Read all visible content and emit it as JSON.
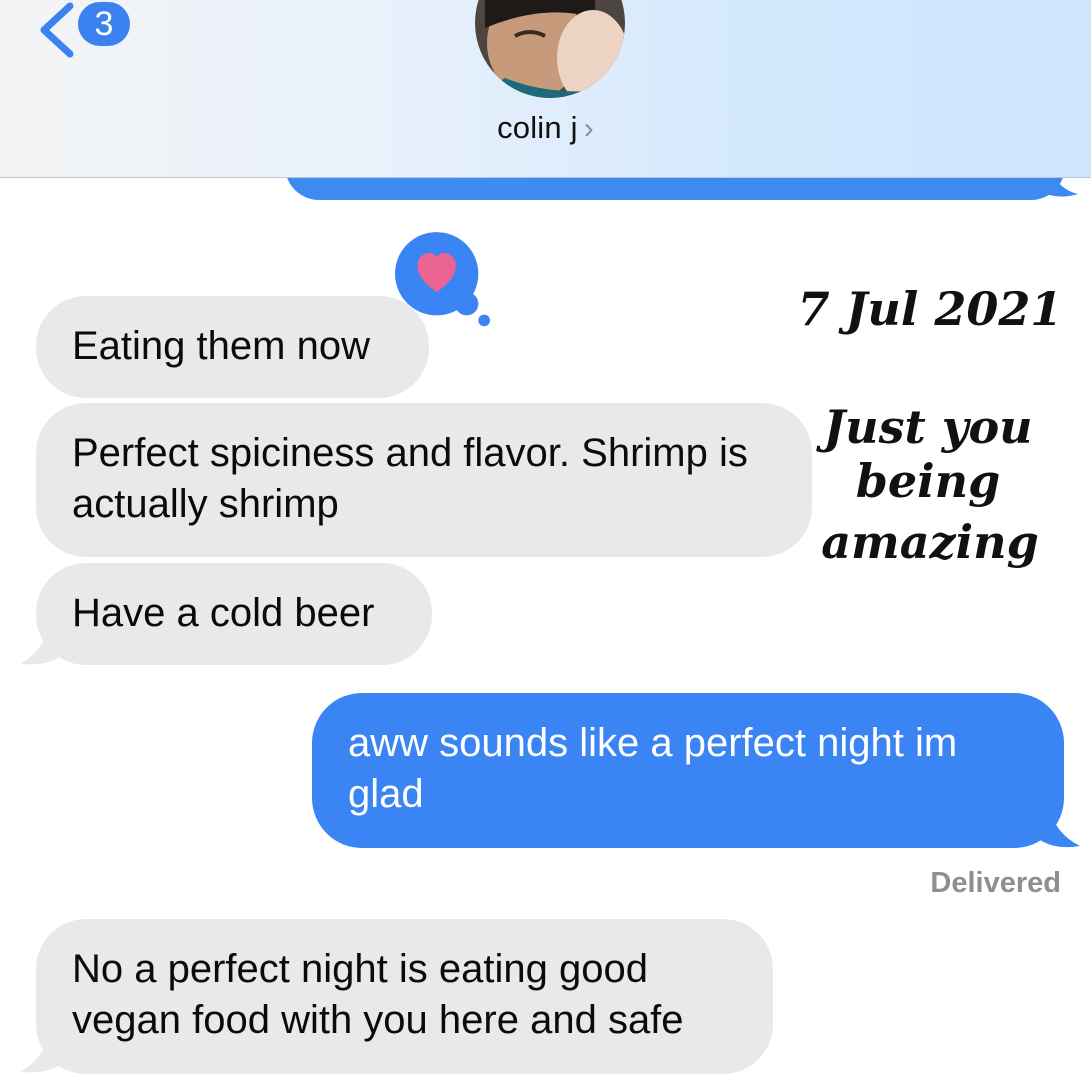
{
  "header": {
    "unread_count": "3",
    "contact_name": "colin j",
    "chevron": "›",
    "back_icon": "chevron-left-icon",
    "avatar": "contact-avatar-photo"
  },
  "reaction": {
    "icon": "heart-icon",
    "color": "#ea6391"
  },
  "messages": [
    {
      "direction": "incoming",
      "text": "Eating them now"
    },
    {
      "direction": "incoming",
      "text": "Perfect spiciness and flavor. Shrimp is actually shrimp"
    },
    {
      "direction": "incoming",
      "text": "Have a cold beer"
    },
    {
      "direction": "outgoing",
      "text": "aww sounds like a perfect night im glad"
    },
    {
      "direction": "incoming",
      "text": "No a perfect night is eating good vegan food with you here and safe"
    }
  ],
  "status": {
    "delivered": "Delivered"
  },
  "overlay": {
    "date": "7 Jul 2021",
    "caption_line1": "Just you being",
    "caption_line2": "amazing"
  },
  "colors": {
    "outgoing_bubble": "#3b84f4",
    "incoming_bubble": "#e9e9eb",
    "badge": "#3b82f0"
  }
}
